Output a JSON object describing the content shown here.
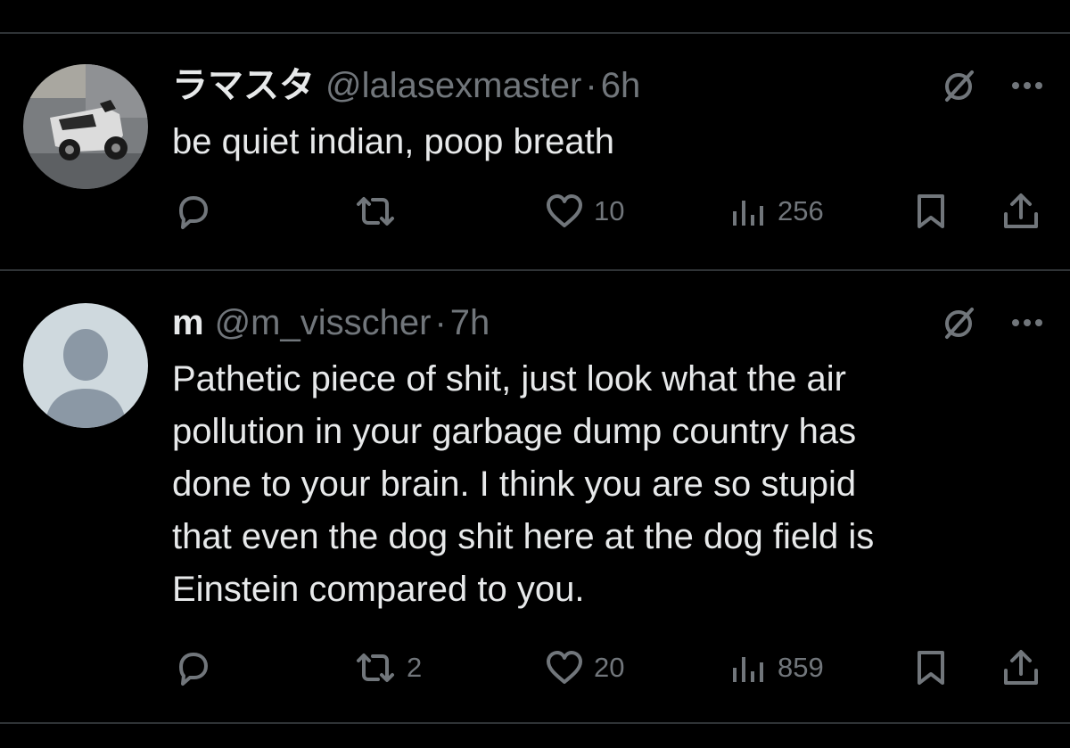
{
  "tweets": [
    {
      "display_name": "ラマスタ",
      "handle": "@lalasexmaster",
      "separator": "·",
      "time": "6h",
      "text": "be quiet indian, poop breath",
      "avatar": "scooter-photo",
      "replies": "",
      "reposts": "",
      "likes": "10",
      "views": "256"
    },
    {
      "display_name": "m",
      "handle": "@m_visscher",
      "separator": "·",
      "time": "7h",
      "text": "Pathetic piece of shit, just look what the air\npollution in your garbage dump country has\ndone to your brain. I think you are so stupid\nthat even the dog shit here at the dog field is\nEinstein compared to you.",
      "avatar": "default-profile",
      "replies": "",
      "reposts": "2",
      "likes": "20",
      "views": "859"
    }
  ],
  "icons": {
    "grok": "grok-icon",
    "more": "more-icon",
    "reply": "reply-icon",
    "repost": "repost-icon",
    "like": "like-icon",
    "views": "views-icon",
    "bookmark": "bookmark-icon",
    "share": "share-icon"
  },
  "colors": {
    "background": "#000000",
    "primary_text": "#e7e9ea",
    "secondary_text": "#71767b",
    "divider": "#2f3336"
  }
}
